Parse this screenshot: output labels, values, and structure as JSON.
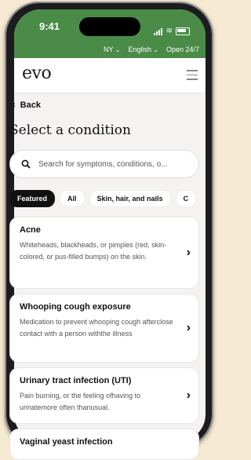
{
  "status_bar": {
    "time": "9:41"
  },
  "top_bar": {
    "region": "NY",
    "language": "English",
    "hours": "Open 24/7"
  },
  "header": {
    "logo": "evo"
  },
  "nav": {
    "back_label": "Back"
  },
  "page": {
    "title": "Select a condition"
  },
  "search": {
    "placeholder": "Search for symptoms, conditions, o..."
  },
  "filters": [
    {
      "label": "Featured",
      "active": true
    },
    {
      "label": "All",
      "active": false
    },
    {
      "label": "Skin, hair, and nails",
      "active": false
    },
    {
      "label": "C",
      "active": false
    }
  ],
  "conditions": [
    {
      "title": "Acne",
      "description": "Whiteheads, blackheads, or pimples (red, skin-colored, or pus-filled bumps) on the skin."
    },
    {
      "title": "Whooping cough exposure",
      "description": "Medication to prevent whooping cough afterclose contact with a person withthe illness"
    },
    {
      "title": "Urinary tract infection (UTI)",
      "description": "Pain burning, or the feeling ofhaving to urinatemore often thanusual."
    },
    {
      "title": "Vaginal yeast infection",
      "description": ""
    }
  ],
  "colors": {
    "brand_green": "#4a8b48",
    "background": "#f6ead2"
  }
}
